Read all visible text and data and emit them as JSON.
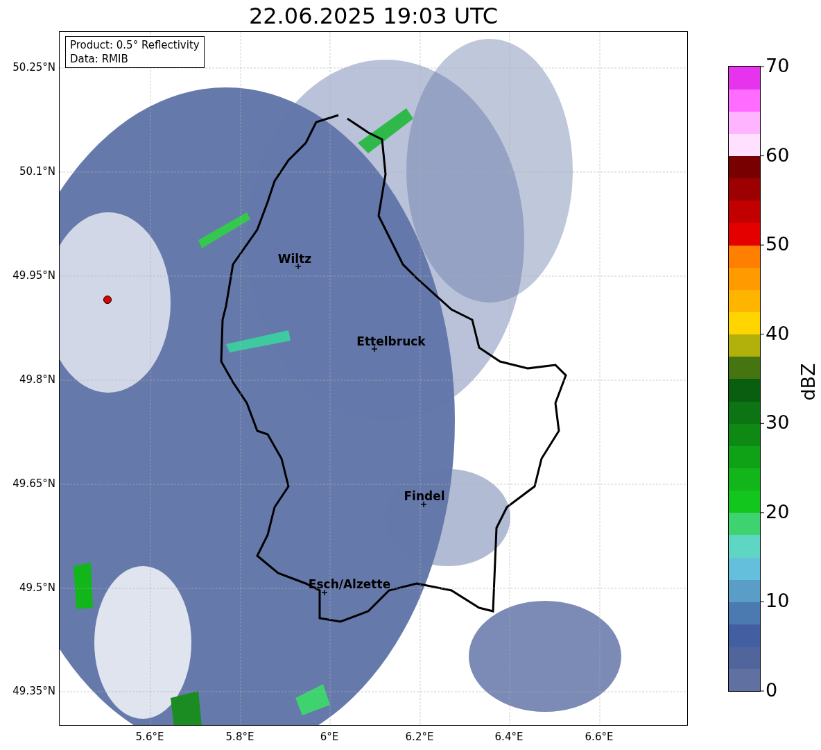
{
  "title": "22.06.2025 19:03 UTC",
  "info_box": {
    "lines": [
      "Product: 0.5° Reflectivity",
      "Data: RMIB"
    ]
  },
  "y_ticks": [
    "50.25°N",
    "50.1°N",
    "49.95°N",
    "49.8°N",
    "49.65°N",
    "49.5°N",
    "49.35°N"
  ],
  "x_ticks": [
    "5.6°E",
    "5.8°E",
    "6°E",
    "6.2°E",
    "6.4°E",
    "6.6°E"
  ],
  "cities": [
    "Wiltz",
    "Ettelbruck",
    "Findel",
    "Esch/Alzette"
  ],
  "colorbar": {
    "label": "dBZ",
    "ticks": [
      "70",
      "60",
      "50",
      "40",
      "30",
      "20",
      "10",
      "0"
    ],
    "bins": [
      {
        "color": "#6070a0"
      },
      {
        "color": "#50659c"
      },
      {
        "color": "#435ea1"
      },
      {
        "color": "#4a7ab0"
      },
      {
        "color": "#5a9ec8"
      },
      {
        "color": "#64bfdc"
      },
      {
        "color": "#5fd6c4"
      },
      {
        "color": "#3ed36e"
      },
      {
        "color": "#12c61e"
      },
      {
        "color": "#12b61a"
      },
      {
        "color": "#10a216"
      },
      {
        "color": "#0e8a14"
      },
      {
        "color": "#0c7412"
      },
      {
        "color": "#0a5e10"
      },
      {
        "color": "#457411"
      },
      {
        "color": "#b2b00a"
      },
      {
        "color": "#ffd500"
      },
      {
        "color": "#ffb500"
      },
      {
        "color": "#ff9a00"
      },
      {
        "color": "#ff8000"
      },
      {
        "color": "#e50000"
      },
      {
        "color": "#c20000"
      },
      {
        "color": "#9c0000"
      },
      {
        "color": "#780000"
      },
      {
        "color": "#ffe0ff"
      },
      {
        "color": "#ffb4ff"
      },
      {
        "color": "#ff6cff"
      },
      {
        "color": "#e633ee"
      }
    ]
  }
}
